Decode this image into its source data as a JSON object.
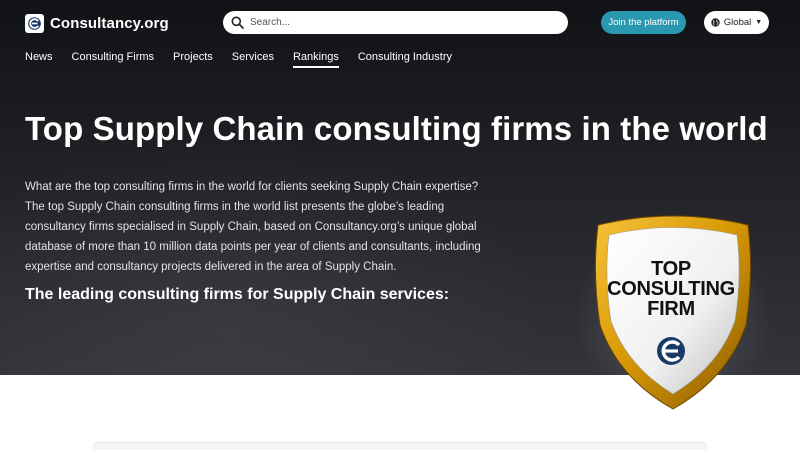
{
  "header": {
    "logo_text": "Consultancy.org",
    "search_placeholder": "Search...",
    "join_label": "Join the platform",
    "region_label": "Global"
  },
  "nav": {
    "items": [
      {
        "label": "News"
      },
      {
        "label": "Consulting Firms"
      },
      {
        "label": "Projects"
      },
      {
        "label": "Services"
      },
      {
        "label": "Rankings"
      },
      {
        "label": "Consulting Industry"
      }
    ],
    "active": "Rankings"
  },
  "hero": {
    "title": "Top Supply Chain consulting firms in the world",
    "description": "What are the top consulting firms in the world for clients seeking Supply Chain expertise? The top Supply Chain consulting firms in the world list presents the globe’s leading consultancy firms specialised in Supply Chain, based on Consultancy.org’s unique global database of more than 10 million data points per year of clients and consultants, including expertise and consultancy projects delivered in the area of Supply Chain.",
    "subheading": "The leading consulting firms for Supply Chain services:"
  },
  "badge": {
    "line1": "TOP",
    "line2": "CONSULTING",
    "line3": "FIRM"
  },
  "colors": {
    "accent": "#2a98b0",
    "badge_gold": "#d99a06",
    "logo_blue": "#1a3a66"
  },
  "icons": [
    "logo-icon",
    "search-icon",
    "globe-icon",
    "chevron-down-icon"
  ]
}
